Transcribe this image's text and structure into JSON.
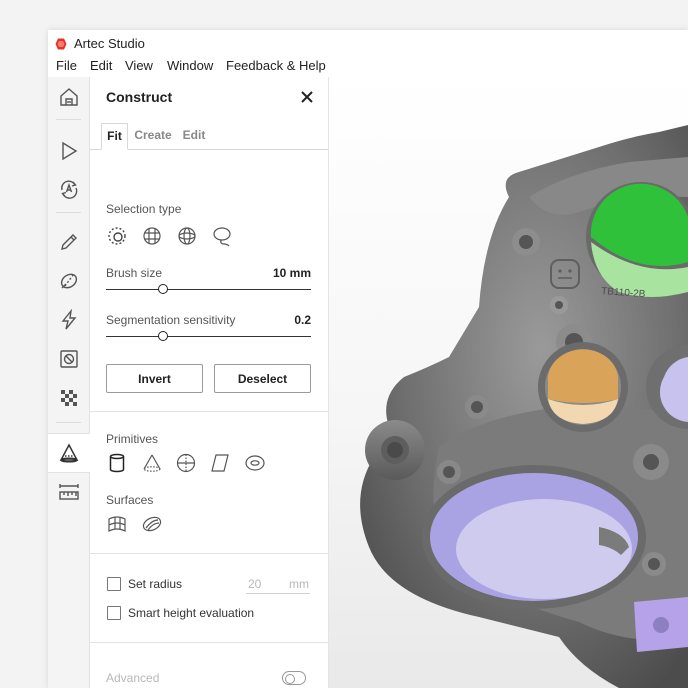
{
  "app": {
    "title": "Artec Studio"
  },
  "menu": [
    "File",
    "Edit",
    "View",
    "Window",
    "Feedback & Help"
  ],
  "toolbar": {
    "items": [
      "home-icon",
      "play-icon",
      "autopilot-icon",
      "pencil-icon",
      "eraser-icon",
      "lightning-icon",
      "fix-holes-icon",
      "texture-icon",
      "construct-icon",
      "measure-icon"
    ],
    "active": "construct-icon"
  },
  "panel": {
    "title": "Construct",
    "tabs": [
      "Fit",
      "Create",
      "Edit"
    ],
    "active_tab": "Fit",
    "selection_type": {
      "label": "Selection type",
      "tools": [
        "brush-select-icon",
        "grid-select-icon",
        "sphere-select-icon",
        "lasso-select-icon"
      ]
    },
    "brush_size": {
      "label": "Brush size",
      "value_text": "10 mm",
      "level": 0.28
    },
    "segmentation": {
      "label": "Segmentation sensitivity",
      "value_text": "0.2",
      "level": 0.28
    },
    "invert_label": "Invert",
    "deselect_label": "Deselect",
    "primitives": {
      "label": "Primitives",
      "items": [
        "cylinder-icon",
        "cone-icon",
        "sphere-icon",
        "plane-icon",
        "torus-icon"
      ]
    },
    "surfaces": {
      "label": "Surfaces",
      "items": [
        "freeform-surface-icon",
        "revolve-surface-icon"
      ]
    },
    "set_radius": {
      "label": "Set radius",
      "value": "20",
      "unit": "mm",
      "checked": false
    },
    "smart_height": {
      "label": "Smart height evaluation",
      "checked": false
    },
    "advanced": {
      "label": "Advanced",
      "enabled": false
    }
  },
  "viewport": {
    "engraving": "TB110-2B",
    "highlight_colors": {
      "green": "#2fc13a",
      "orange": "#d9a45a",
      "purple": "#a9a3e4"
    }
  }
}
